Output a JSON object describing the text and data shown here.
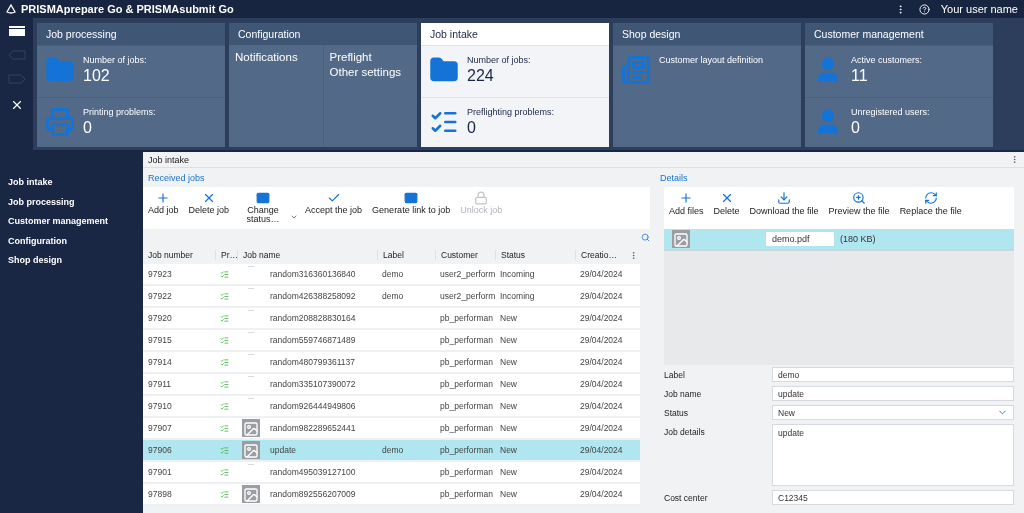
{
  "app": {
    "title": "PRISMAprepare Go & PRISMAsubmit Go",
    "user_name": "Your user name"
  },
  "tiles": [
    {
      "title": "Job processing",
      "selected": false,
      "kind": "stats",
      "items": [
        {
          "label": "Number of jobs:",
          "value": "102"
        },
        {
          "label": "Printing problems:",
          "value": "0"
        }
      ]
    },
    {
      "title": "Configuration",
      "selected": false,
      "kind": "links",
      "columns": [
        [
          "Notifications"
        ],
        [
          "Preflight",
          "Other settings"
        ]
      ]
    },
    {
      "title": "Job intake",
      "selected": true,
      "kind": "stats",
      "items": [
        {
          "label": "Number of jobs:",
          "value": "224"
        },
        {
          "label": "Preflighting problems:",
          "value": "0"
        }
      ]
    },
    {
      "title": "Shop design",
      "selected": false,
      "kind": "stats",
      "items": [
        {
          "label": "Customer layout definition"
        }
      ]
    },
    {
      "title": "Customer management",
      "selected": false,
      "kind": "stats",
      "items": [
        {
          "label": "Active customers:",
          "value": "11"
        },
        {
          "label": "Unregistered users:",
          "value": "0"
        }
      ]
    }
  ],
  "sidebar": {
    "items": [
      {
        "label": "Job intake"
      },
      {
        "label": "Job processing"
      },
      {
        "label": "Customer management"
      },
      {
        "label": "Configuration"
      },
      {
        "label": "Shop design"
      }
    ]
  },
  "panel_title": "Job intake",
  "received_jobs": {
    "title": "Received jobs",
    "toolbar": [
      {
        "label": "Add job",
        "disabled": false,
        "kind": "button"
      },
      {
        "label": "Delete job",
        "disabled": false,
        "kind": "button"
      },
      {
        "label": "Change status…",
        "disabled": false,
        "kind": "menu"
      },
      {
        "label": "Accept the job",
        "disabled": false,
        "kind": "button"
      },
      {
        "label": "Generate link to job",
        "disabled": false,
        "kind": "button"
      },
      {
        "label": "Unlock job",
        "disabled": true,
        "kind": "button"
      }
    ],
    "columns": [
      "Job number",
      "Pr…",
      "Job name",
      "Label",
      "Customer",
      "Status",
      "Creatio…"
    ],
    "rows": [
      {
        "job_number": "97923",
        "thumbnail": false,
        "job_name": "random316360136840",
        "label": "demo",
        "customer": "user2_perform",
        "status": "Incoming",
        "created": "29/04/2024",
        "selected": false
      },
      {
        "job_number": "97922",
        "thumbnail": false,
        "job_name": "random426388258092",
        "label": "demo",
        "customer": "user2_perform",
        "status": "Incoming",
        "created": "29/04/2024",
        "selected": false
      },
      {
        "job_number": "97920",
        "thumbnail": false,
        "job_name": "random208828830164",
        "customer": "pb_performan",
        "status": "New",
        "created": "29/04/2024",
        "selected": false
      },
      {
        "job_number": "97915",
        "thumbnail": false,
        "job_name": "random559746871489",
        "customer": "pb_performan",
        "status": "New",
        "created": "29/04/2024",
        "selected": false
      },
      {
        "job_number": "97914",
        "thumbnail": false,
        "job_name": "random480799361137",
        "customer": "pb_performan",
        "status": "New",
        "created": "29/04/2024",
        "selected": false
      },
      {
        "job_number": "97911",
        "thumbnail": false,
        "job_name": "random335107390072",
        "customer": "pb_performan",
        "status": "New",
        "created": "29/04/2024",
        "selected": false
      },
      {
        "job_number": "97910",
        "thumbnail": false,
        "job_name": "random926444949806",
        "customer": "pb_performan",
        "status": "New",
        "created": "29/04/2024",
        "selected": false
      },
      {
        "job_number": "97907",
        "thumbnail": true,
        "job_name": "random982289652441",
        "customer": "pb_performan",
        "status": "New",
        "created": "29/04/2024",
        "selected": false
      },
      {
        "job_number": "97906",
        "thumbnail": true,
        "job_name": "update",
        "label": "demo",
        "customer": "pb_performan",
        "status": "New",
        "created": "29/04/2024",
        "selected": true
      },
      {
        "job_number": "97901",
        "thumbnail": false,
        "job_name": "random495039127100",
        "customer": "pb_performan",
        "status": "New",
        "created": "29/04/2024",
        "selected": false
      },
      {
        "job_number": "97898",
        "thumbnail": true,
        "job_name": "random892556207009",
        "customer": "pb_performan",
        "status": "New",
        "created": "29/04/2024",
        "selected": false
      }
    ]
  },
  "details": {
    "title": "Details",
    "toolbar": [
      {
        "label": "Add files"
      },
      {
        "label": "Delete"
      },
      {
        "label": "Download the file"
      },
      {
        "label": "Preview the file"
      },
      {
        "label": "Replace the file"
      }
    ],
    "file": {
      "name": "demo.pdf",
      "size": "(180 KB)",
      "selected": true
    },
    "fields": [
      {
        "label": "Label",
        "value": "demo",
        "kind": "text"
      },
      {
        "label": "Job name",
        "value": "update",
        "kind": "text"
      },
      {
        "label": "Status",
        "value": "New",
        "kind": "select"
      },
      {
        "label": "Job details",
        "value": "update",
        "kind": "textarea"
      },
      {
        "label": "Cost center",
        "value": "C12345",
        "kind": "text"
      }
    ]
  }
}
